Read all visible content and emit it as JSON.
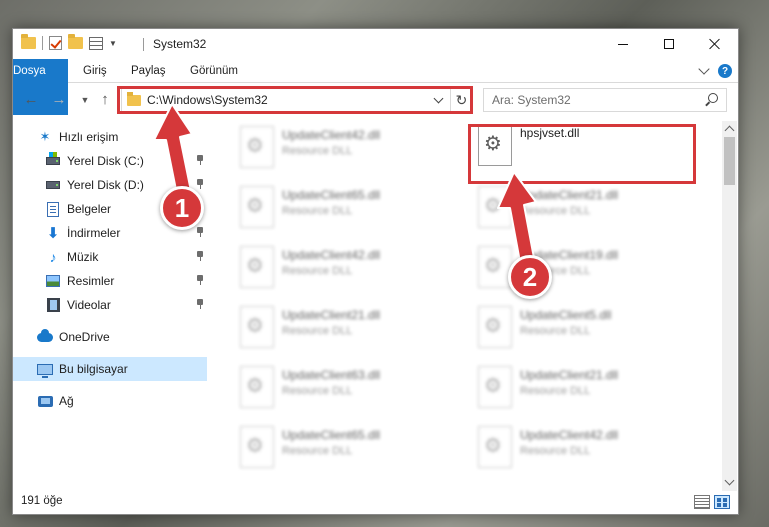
{
  "window": {
    "title": "System32"
  },
  "ribbon": {
    "tabs": [
      "Dosya",
      "Giriş",
      "Paylaş",
      "Görünüm"
    ],
    "active_tab": "Dosya",
    "accent_color": "#1979ca"
  },
  "nav": {
    "address_path": "C:\\Windows\\System32",
    "search_placeholder": "Ara: System32"
  },
  "sidebar": {
    "items": [
      {
        "label": "Hızlı erişim",
        "icon": "star-icon",
        "pinned": false
      },
      {
        "label": "Yerel Disk (C:)",
        "icon": "drive-c-icon",
        "pinned": true
      },
      {
        "label": "Yerel Disk (D:)",
        "icon": "drive-d-icon",
        "pinned": true
      },
      {
        "label": "Belgeler",
        "icon": "documents-icon",
        "pinned": true
      },
      {
        "label": "İndirmeler",
        "icon": "downloads-icon",
        "pinned": true
      },
      {
        "label": "Müzik",
        "icon": "music-icon",
        "pinned": true
      },
      {
        "label": "Resimler",
        "icon": "pictures-icon",
        "pinned": true
      },
      {
        "label": "Videolar",
        "icon": "videos-icon",
        "pinned": true
      },
      {
        "label": "OneDrive",
        "icon": "onedrive-icon",
        "pinned": false
      },
      {
        "label": "Bu bilgisayar",
        "icon": "this-pc-icon",
        "pinned": false,
        "selected": true
      },
      {
        "label": "Ağ",
        "icon": "network-icon",
        "pinned": false
      }
    ]
  },
  "files": {
    "left_column": [
      {
        "name": "UpdateClient42.dll",
        "type": "Resource DLL"
      },
      {
        "name": "UpdateClient65.dll",
        "type": "Resource DLL"
      },
      {
        "name": "UpdateClient42.dll",
        "type": "Resource DLL"
      },
      {
        "name": "UpdateClient21.dll",
        "type": "Resource DLL"
      },
      {
        "name": "UpdateClient63.dll",
        "type": "Resource DLL"
      },
      {
        "name": "UpdateClient65.dll",
        "type": "Resource DLL"
      }
    ],
    "right_column": [
      {
        "name": "hpsjvset.dll",
        "type": "",
        "highlighted": true
      },
      {
        "name": "UpdateClient21.dll",
        "type": "Resource DLL"
      },
      {
        "name": "UpdateClient19.dll",
        "type": "Resource DLL"
      },
      {
        "name": "UpdateClient5.dll",
        "type": "Resource DLL"
      },
      {
        "name": "UpdateClient21.dll",
        "type": "Resource DLL"
      },
      {
        "name": "UpdateClient42.dll",
        "type": "Resource DLL"
      }
    ]
  },
  "status": {
    "item_count": "191 öğe"
  },
  "annotations": {
    "badge_1": "1",
    "badge_2": "2",
    "color": "#d5383a"
  }
}
